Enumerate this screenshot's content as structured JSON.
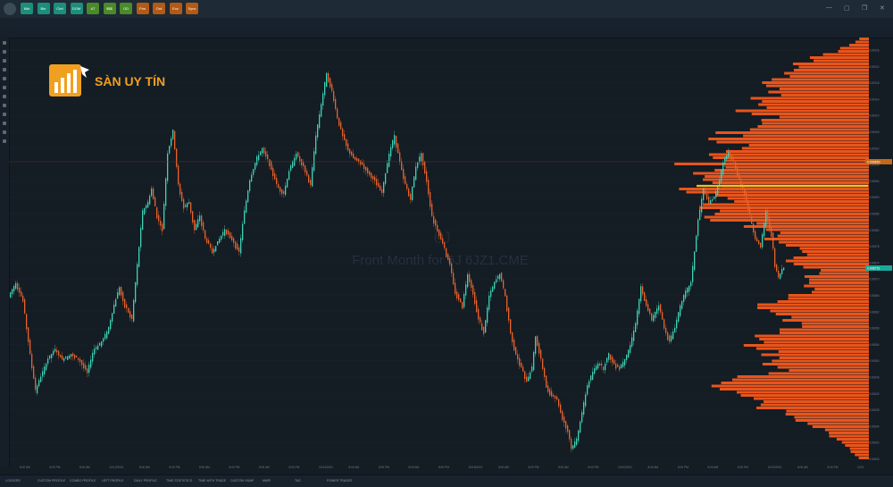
{
  "brand": {
    "name": "SÀN UY TÍN"
  },
  "chart_overlay": {
    "symbol_watermark": "6J",
    "description_watermark": "Front Month for 6J  6JZ1.CME"
  },
  "colors": {
    "background": "#141c24",
    "up_candle": "#3fd3b5",
    "down_candle": "#e8632c",
    "profile": "#e8551c",
    "poc_line": "#f2c21a",
    "price_label": "#1aa89a"
  },
  "toolbar_buttons": [
    {
      "label": "Mkt",
      "color": "#1b8f7b"
    },
    {
      "label": "Bkr",
      "color": "#1b8f7b"
    },
    {
      "label": "Chrt",
      "color": "#1b8f7b"
    },
    {
      "label": "DOM",
      "color": "#1b8f7b"
    },
    {
      "label": "AT",
      "color": "#4a8a2a"
    },
    {
      "label": "$$$",
      "color": "#4a8a2a"
    },
    {
      "label": "OD",
      "color": "#4a8a2a"
    },
    {
      "label": "Pos",
      "color": "#b35a16"
    },
    {
      "label": "Ord",
      "color": "#b35a16"
    },
    {
      "label": "Exc",
      "color": "#b35a16"
    },
    {
      "label": "Sync",
      "color": "#b35a16"
    }
  ],
  "axis": {
    "price_labels": [
      "0.00926",
      "0.00922",
      "0.00918",
      "0.00914",
      "0.00910",
      "0.00906",
      "0.00902",
      "0.00898",
      "0.00894",
      "0.00890",
      "0.00886",
      "0.00882",
      "0.00878",
      "0.00874",
      "0.00870",
      "0.00866",
      "0.00862",
      "0.00858",
      "0.00854",
      "0.00850",
      "0.00846",
      "0.00842",
      "0.00838",
      "0.00834",
      "0.00830",
      "0.00826"
    ],
    "current_price": "0.008751",
    "crosshair_price": "0.008850",
    "time_labels": [
      "8:00 AM",
      "8:00 PM",
      "8:00 AM",
      "10/12/2021",
      "8:00 AM",
      "8:00 PM",
      "8:00 AM",
      "8:00 PM",
      "8:00 AM",
      "8:00 PM",
      "10/14/2021",
      "8:00 AM",
      "8:00 PM",
      "8:00 AM",
      "8:00 PM",
      "10/18/2021",
      "8:00 AM",
      "8:00 PM",
      "8:00 AM",
      "8:00 PM",
      "10/20/2021",
      "8:00 AM",
      "8:00 PM",
      "8:00 AM",
      "8:00 PM",
      "10/22/2021",
      "8:00 AM",
      "8:00 PM",
      "11/01"
    ]
  },
  "bottom_tabs": [
    "LOCKERS",
    "CUSTOM PROFILE",
    "COMBO PROFILE",
    "LEFT PROFILE",
    "DAILY PROFILE",
    "TIME STATISTICS",
    "TIME WITH TRADE",
    "CUSTOM VWAP",
    "MMPI",
    "TAS",
    "POWER TRADES"
  ]
}
